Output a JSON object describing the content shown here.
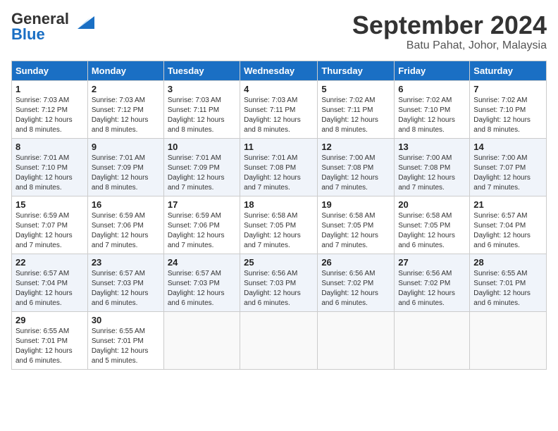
{
  "header": {
    "logo_general": "General",
    "logo_blue": "Blue",
    "month": "September 2024",
    "location": "Batu Pahat, Johor, Malaysia"
  },
  "days_of_week": [
    "Sunday",
    "Monday",
    "Tuesday",
    "Wednesday",
    "Thursday",
    "Friday",
    "Saturday"
  ],
  "weeks": [
    [
      {
        "day": "1",
        "sunrise": "7:03 AM",
        "sunset": "7:12 PM",
        "daylight": "12 hours and 8 minutes."
      },
      {
        "day": "2",
        "sunrise": "7:03 AM",
        "sunset": "7:12 PM",
        "daylight": "12 hours and 8 minutes."
      },
      {
        "day": "3",
        "sunrise": "7:03 AM",
        "sunset": "7:11 PM",
        "daylight": "12 hours and 8 minutes."
      },
      {
        "day": "4",
        "sunrise": "7:03 AM",
        "sunset": "7:11 PM",
        "daylight": "12 hours and 8 minutes."
      },
      {
        "day": "5",
        "sunrise": "7:02 AM",
        "sunset": "7:11 PM",
        "daylight": "12 hours and 8 minutes."
      },
      {
        "day": "6",
        "sunrise": "7:02 AM",
        "sunset": "7:10 PM",
        "daylight": "12 hours and 8 minutes."
      },
      {
        "day": "7",
        "sunrise": "7:02 AM",
        "sunset": "7:10 PM",
        "daylight": "12 hours and 8 minutes."
      }
    ],
    [
      {
        "day": "8",
        "sunrise": "7:01 AM",
        "sunset": "7:10 PM",
        "daylight": "12 hours and 8 minutes."
      },
      {
        "day": "9",
        "sunrise": "7:01 AM",
        "sunset": "7:09 PM",
        "daylight": "12 hours and 8 minutes."
      },
      {
        "day": "10",
        "sunrise": "7:01 AM",
        "sunset": "7:09 PM",
        "daylight": "12 hours and 7 minutes."
      },
      {
        "day": "11",
        "sunrise": "7:01 AM",
        "sunset": "7:08 PM",
        "daylight": "12 hours and 7 minutes."
      },
      {
        "day": "12",
        "sunrise": "7:00 AM",
        "sunset": "7:08 PM",
        "daylight": "12 hours and 7 minutes."
      },
      {
        "day": "13",
        "sunrise": "7:00 AM",
        "sunset": "7:08 PM",
        "daylight": "12 hours and 7 minutes."
      },
      {
        "day": "14",
        "sunrise": "7:00 AM",
        "sunset": "7:07 PM",
        "daylight": "12 hours and 7 minutes."
      }
    ],
    [
      {
        "day": "15",
        "sunrise": "6:59 AM",
        "sunset": "7:07 PM",
        "daylight": "12 hours and 7 minutes."
      },
      {
        "day": "16",
        "sunrise": "6:59 AM",
        "sunset": "7:06 PM",
        "daylight": "12 hours and 7 minutes."
      },
      {
        "day": "17",
        "sunrise": "6:59 AM",
        "sunset": "7:06 PM",
        "daylight": "12 hours and 7 minutes."
      },
      {
        "day": "18",
        "sunrise": "6:58 AM",
        "sunset": "7:05 PM",
        "daylight": "12 hours and 7 minutes."
      },
      {
        "day": "19",
        "sunrise": "6:58 AM",
        "sunset": "7:05 PM",
        "daylight": "12 hours and 7 minutes."
      },
      {
        "day": "20",
        "sunrise": "6:58 AM",
        "sunset": "7:05 PM",
        "daylight": "12 hours and 6 minutes."
      },
      {
        "day": "21",
        "sunrise": "6:57 AM",
        "sunset": "7:04 PM",
        "daylight": "12 hours and 6 minutes."
      }
    ],
    [
      {
        "day": "22",
        "sunrise": "6:57 AM",
        "sunset": "7:04 PM",
        "daylight": "12 hours and 6 minutes."
      },
      {
        "day": "23",
        "sunrise": "6:57 AM",
        "sunset": "7:03 PM",
        "daylight": "12 hours and 6 minutes."
      },
      {
        "day": "24",
        "sunrise": "6:57 AM",
        "sunset": "7:03 PM",
        "daylight": "12 hours and 6 minutes."
      },
      {
        "day": "25",
        "sunrise": "6:56 AM",
        "sunset": "7:03 PM",
        "daylight": "12 hours and 6 minutes."
      },
      {
        "day": "26",
        "sunrise": "6:56 AM",
        "sunset": "7:02 PM",
        "daylight": "12 hours and 6 minutes."
      },
      {
        "day": "27",
        "sunrise": "6:56 AM",
        "sunset": "7:02 PM",
        "daylight": "12 hours and 6 minutes."
      },
      {
        "day": "28",
        "sunrise": "6:55 AM",
        "sunset": "7:01 PM",
        "daylight": "12 hours and 6 minutes."
      }
    ],
    [
      {
        "day": "29",
        "sunrise": "6:55 AM",
        "sunset": "7:01 PM",
        "daylight": "12 hours and 6 minutes."
      },
      {
        "day": "30",
        "sunrise": "6:55 AM",
        "sunset": "7:01 PM",
        "daylight": "12 hours and 5 minutes."
      },
      null,
      null,
      null,
      null,
      null
    ]
  ]
}
